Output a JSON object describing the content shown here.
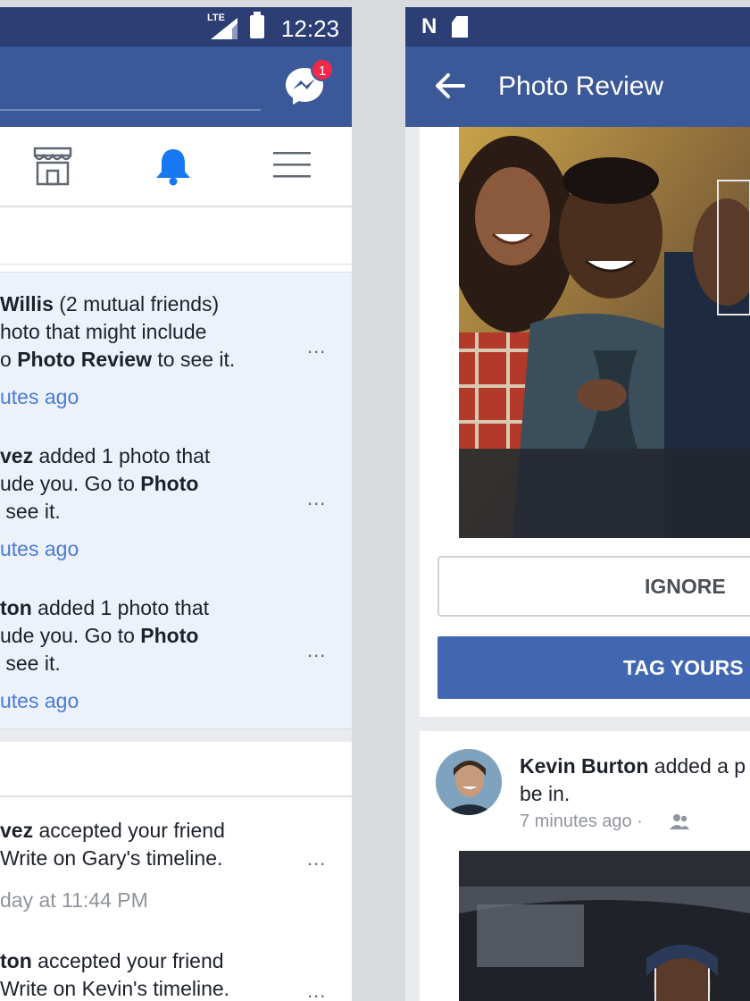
{
  "left": {
    "status": {
      "network": "LTE",
      "time": "12:23"
    },
    "messenger_badge": "1",
    "nav_icons": [
      "marketplace-icon",
      "bell-icon",
      "menu-icon"
    ],
    "unread": [
      {
        "line1_bold": "Willis",
        "line1_rest": " (2 mutual friends)",
        "line2": "hoto that might include",
        "line3_pre": "o ",
        "line3_bold": "Photo Review",
        "line3_post": " to see it.",
        "time": "utes ago"
      },
      {
        "line1_bold": "vez",
        "line1_rest": " added 1 photo that",
        "line2_pre": "ude you. Go to ",
        "line2_bold": "Photo",
        "line3": " see it.",
        "time": "utes ago"
      },
      {
        "line1_bold": "ton",
        "line1_rest": " added 1 photo that",
        "line2_pre": "ude you. Go to ",
        "line2_bold": "Photo",
        "line3": " see it.",
        "time": "utes ago"
      }
    ],
    "earlier": [
      {
        "line1_bold": "vez",
        "line1_rest": " accepted your friend",
        "line2": "Write on Gary's timeline.",
        "time": "day at 11:44 PM"
      },
      {
        "line1_bold": "ton",
        "line1_rest": " accepted your friend",
        "line2": "Write on Kevin's timeline."
      }
    ],
    "more_label": "..."
  },
  "right": {
    "title": "Photo Review",
    "ignore_label": "IGNORE",
    "tag_label": "TAG YOURS",
    "post": {
      "author": "Kevin Burton",
      "text_rest": " added a p",
      "line2": "be in.",
      "meta": "7 minutes ago ·"
    }
  },
  "colors": {
    "fb_blue": "#3b5998",
    "status_bar": "#2c3e74",
    "button_blue": "#4267b2",
    "unread_bg": "#edf2fa",
    "link_blue": "#4b7bd6"
  }
}
